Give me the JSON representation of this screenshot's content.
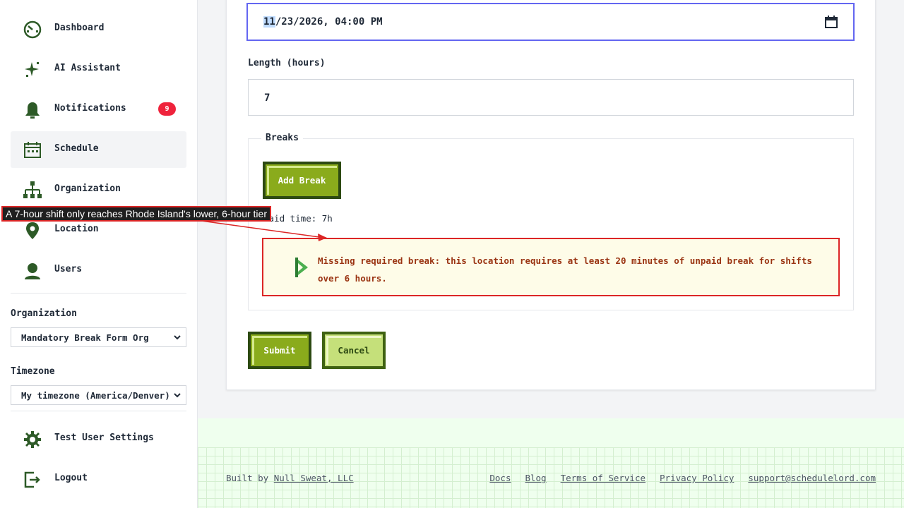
{
  "sidebar": {
    "items": [
      {
        "label": "Dashboard",
        "icon": "dashboard-icon"
      },
      {
        "label": "AI Assistant",
        "icon": "sparkle-icon"
      },
      {
        "label": "Notifications",
        "icon": "bell-icon",
        "badge": "9"
      },
      {
        "label": "Schedule",
        "icon": "calendar-icon",
        "active": true
      },
      {
        "label": "Organization",
        "icon": "org-chart-icon"
      },
      {
        "label": "Location",
        "icon": "location-pin-icon"
      },
      {
        "label": "Users",
        "icon": "user-icon"
      }
    ],
    "organization_label": "Organization",
    "organization_value": "Mandatory Break Form Org",
    "timezone_label": "Timezone",
    "timezone_value": "My timezone (America/Denver)",
    "settings_label": "Test User Settings",
    "logout_label": "Logout"
  },
  "form": {
    "datetime_month": "11",
    "datetime_rest": "/23/2026, 04:00 PM",
    "length_label": "Length (hours)",
    "length_value": "7",
    "breaks_legend": "Breaks",
    "add_break_label": "Add Break",
    "paid_time": "Paid time: 7h",
    "alert_text": "Missing required break: this location requires at least 20 minutes of unpaid break for shifts over 6 hours.",
    "submit_label": "Submit",
    "cancel_label": "Cancel"
  },
  "footer": {
    "built_by_prefix": "Built by ",
    "built_by_link": "Null Sweat, LLC",
    "links": [
      "Docs",
      "Blog",
      "Terms of Service",
      "Privacy Policy",
      "support@schedulelord.com"
    ]
  },
  "annotation": {
    "text": "A 7-hour shift only reaches Rhode Island's lower, 6-hour tier"
  },
  "colors": {
    "icon_green": "#2d5a27",
    "button_green": "#8aab1c",
    "alert_border": "#dc2626",
    "focus_border": "#6366f1",
    "badge_red": "#ef233c"
  }
}
